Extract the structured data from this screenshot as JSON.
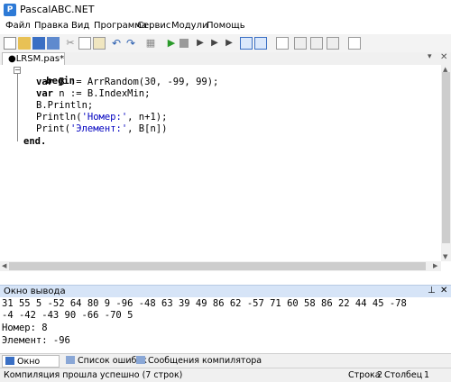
{
  "window": {
    "title": "PascalABC.NET"
  },
  "menu": {
    "items": [
      "Файл",
      "Правка",
      "Вид",
      "Программа",
      "Сервис",
      "Модули",
      "Помощь"
    ]
  },
  "tab": {
    "label": "●LRSM.pas*"
  },
  "code": {
    "begin": "begin",
    "line1": [
      "var",
      " B := ArrRandom(",
      "30",
      ", ",
      "-99",
      ", ",
      "99",
      ");"
    ],
    "line2": [
      "var",
      " n := B.IndexMin;"
    ],
    "line3": "B.Println;",
    "line4": [
      "Println(",
      "'Номер:'",
      ", n+1);"
    ],
    "line5": [
      "Print(",
      "'Элемент:'",
      ", B[n])"
    ],
    "end": "end."
  },
  "output_panel": {
    "title": "Окно вывода",
    "lines": [
      "31 55 5 -52 64 80 9 -96 -48 63 39 49 86 62 -57 71 60 58 86 22 44 45 -78",
      "-4 -42 -43 90 -66 -70 5",
      "Номер: 8",
      "Элемент: -96"
    ]
  },
  "bottom_tabs": [
    "Окно вывода",
    "Список ошибок",
    "Сообщения компилятора"
  ],
  "status": {
    "message": "Компиляция прошла успешно (7 строк)",
    "row_label": "Строка",
    "row_value": "2",
    "col_label": "Столбец",
    "col_value": "1"
  },
  "colors": {
    "string": "#0000c0",
    "output_header": "#d6e4f7",
    "run": "#2a9a2a"
  }
}
